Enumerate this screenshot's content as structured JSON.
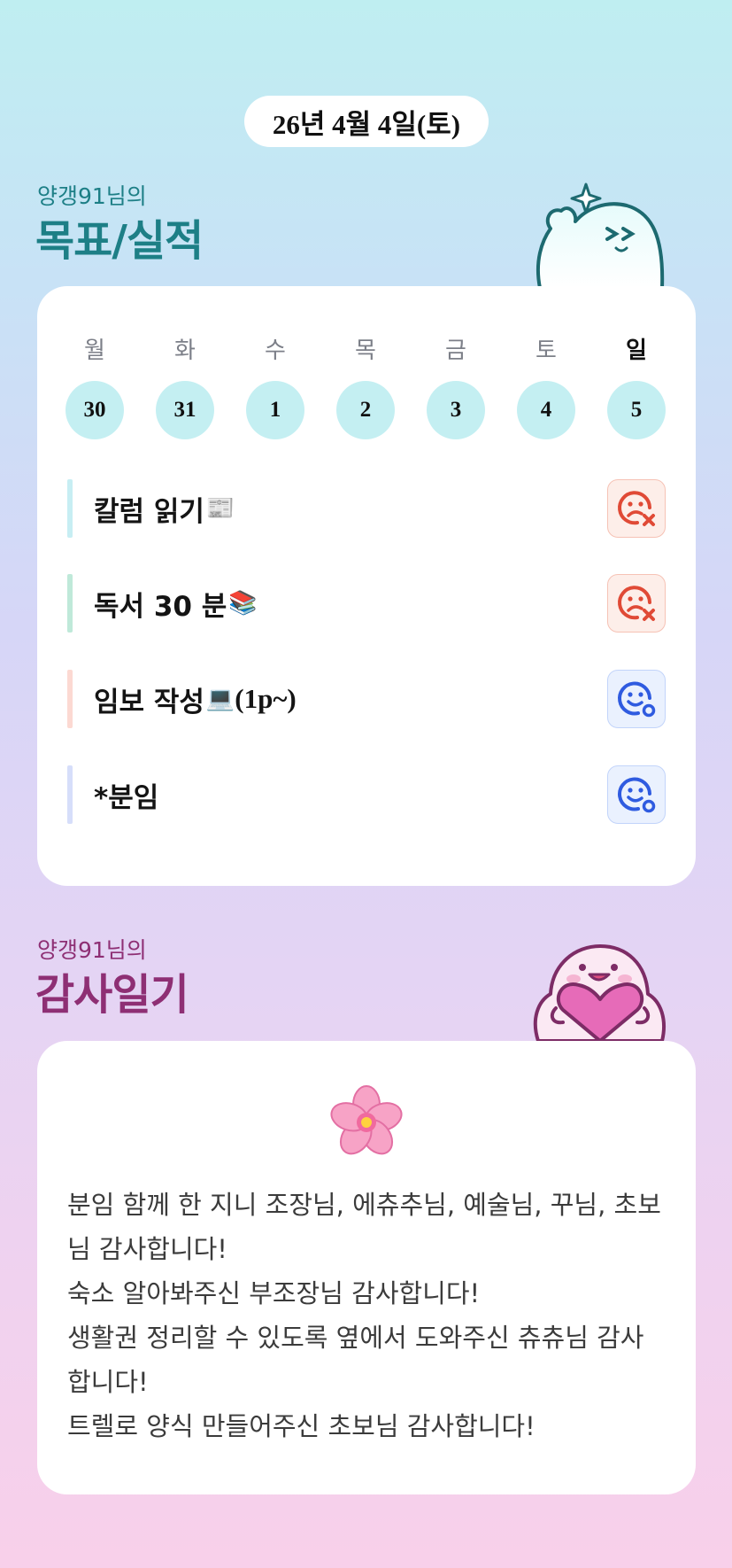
{
  "header": {
    "date": "26년 4월 4일(토)"
  },
  "goals_section": {
    "subtitle": "양갱91님의",
    "title": "목표/실적"
  },
  "week": {
    "days": [
      "월",
      "화",
      "수",
      "목",
      "금",
      "토",
      "일"
    ],
    "dates": [
      "30",
      "31",
      "1",
      "2",
      "3",
      "4",
      "5"
    ]
  },
  "goals": [
    {
      "label": "칼럼 읽기",
      "emoji": "📰",
      "suffix": "",
      "status": "fail",
      "bar_color": "#c7eef3",
      "status_icon": "sad-face-x-icon"
    },
    {
      "label": "독서 30 분",
      "emoji": "📚",
      "suffix": "",
      "status": "done-not",
      "bar_color": "#bfe9d9",
      "status_icon": "sad-face-x-icon"
    },
    {
      "label": "임보 작성",
      "emoji": "💻",
      "suffix": " (1p~)",
      "status": "done",
      "bar_color": "#fcd9d2",
      "status_icon": "smile-face-dot-icon"
    },
    {
      "label": "*분임",
      "emoji": "",
      "suffix": "",
      "status": "done",
      "bar_color": "#d6defa",
      "status_icon": "smile-face-dot-icon"
    }
  ],
  "gratitude_section": {
    "subtitle": "양갱91님의",
    "title": "감사일기",
    "flower_emoji": "🌸",
    "text": "분임 함께 한 지니 조장님, 에츄추님, 예술님, 꾸님, 초보님 감사합니다!\n숙소 알아봐주신 부조장님 감사합니다!\n생활권 정리할 수 있도록 옆에서 도와주신 츄츄님 감사합니다!\n트렐로 양식 만들어주신 초보님 감사합니다!"
  },
  "colors": {
    "teal": "#1d7f86",
    "plum": "#8e2f74",
    "fail": "#e04a36",
    "done": "#2f5be0"
  }
}
